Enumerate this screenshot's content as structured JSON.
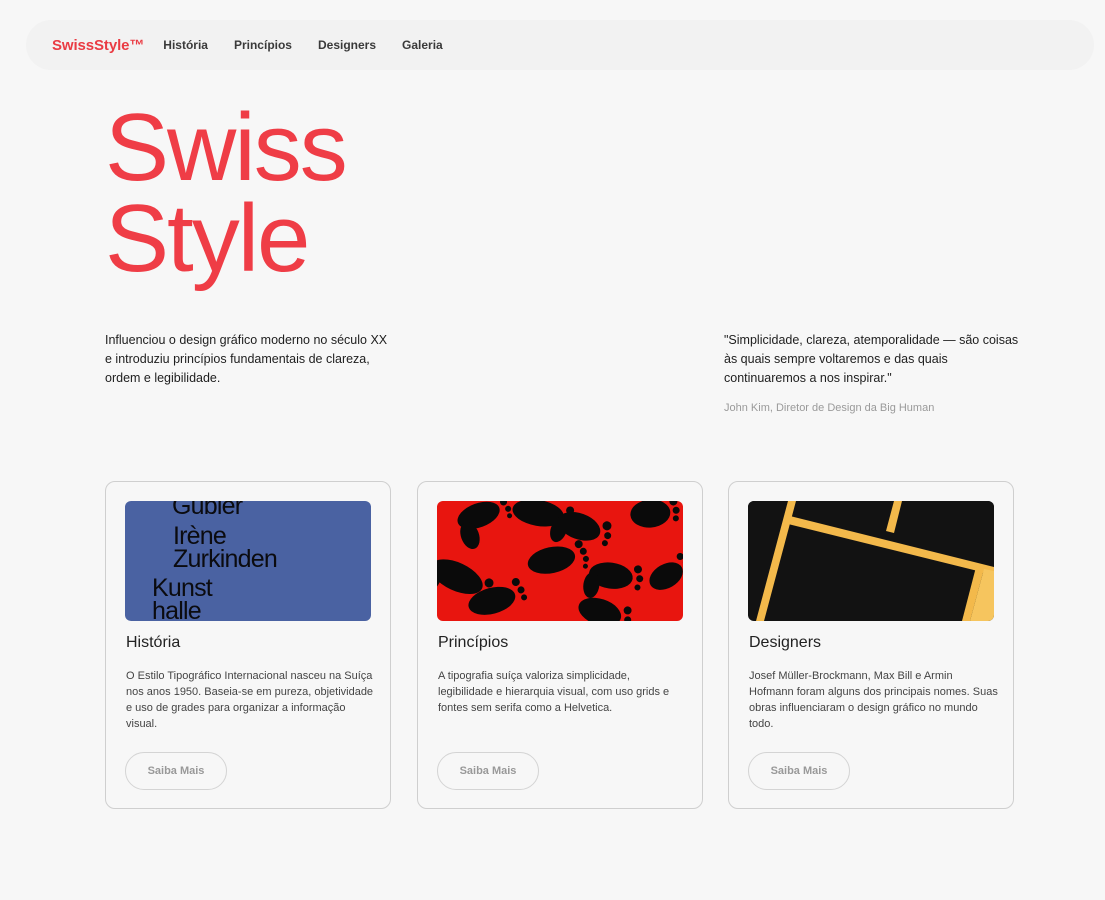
{
  "nav": {
    "brand": "SwissStyle™",
    "links": [
      "História",
      "Princípios",
      "Designers",
      "Galeria"
    ]
  },
  "hero": {
    "title_line1": "Swiss",
    "title_line2": "Style",
    "intro": "Influenciou o design gráfico moderno no século XX e introduziu princípios fundamentais de clareza, ordem e legibilidade.",
    "quote": "\"Simplicidade, clareza, atemporalidade — são coisas às quais sempre voltaremos e das quais continuaremos a nos inspirar.\"",
    "quote_author": "John Kim, Diretor de Design da Big Human"
  },
  "cards": [
    {
      "title": "História",
      "text": "O Estilo Tipográfico Internacional nasceu na Suíça nos anos 1950. Baseia-se em pureza, objetividade e uso de grades para organizar a informação visual.",
      "button": "Saiba Mais",
      "poster_text": [
        "Gubler",
        "Irène",
        "Zurkinden",
        "Kunst",
        "halle"
      ]
    },
    {
      "title": "Princípios",
      "text": "A tipografia suíça valoriza simplicidade, legibilidade e hierarquia visual, com uso grids e fontes sem serifa como a Helvetica.",
      "button": "Saiba Mais"
    },
    {
      "title": "Designers",
      "text": "Josef Müller-Brockmann, Max Bill e Armin Hofmann foram alguns dos principais nomes. Suas obras influenciaram o design gráfico no mundo todo.",
      "button": "Saiba Mais"
    }
  ],
  "colors": {
    "accent": "#ef3d46",
    "background": "#f7f7f7"
  }
}
